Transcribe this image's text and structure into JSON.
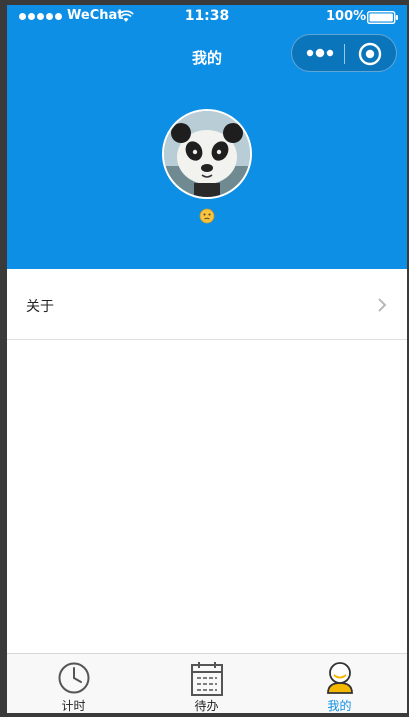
{
  "status_bar": {
    "carrier": "WeChat",
    "time": "11:38",
    "battery": "100%"
  },
  "nav": {
    "title": "我的"
  },
  "profile": {
    "avatar": "panda-avatar",
    "nickname": "emoji"
  },
  "list": {
    "items": [
      {
        "label": "关于"
      }
    ]
  },
  "tabbar": {
    "tabs": [
      {
        "label": "计时",
        "icon": "clock-icon"
      },
      {
        "label": "待办",
        "icon": "calendar-icon"
      },
      {
        "label": "我的",
        "icon": "user-icon",
        "active": true
      }
    ]
  },
  "colors": {
    "accent": "#0e8fe6",
    "divider": "#e0e0e0"
  }
}
